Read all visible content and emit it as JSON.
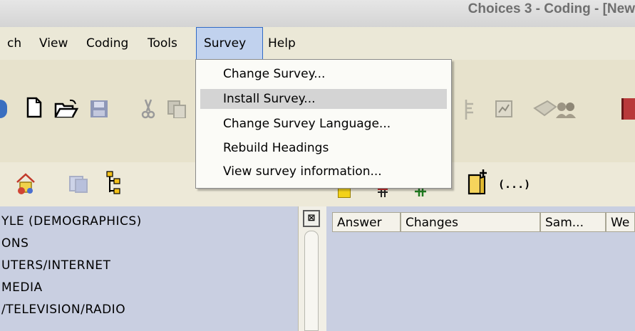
{
  "window": {
    "title": "Choices 3 - Coding - [New"
  },
  "menubar": {
    "items": [
      {
        "label": "ch"
      },
      {
        "label": "View"
      },
      {
        "label": "Coding"
      },
      {
        "label": "Tools"
      },
      {
        "label": "Survey"
      },
      {
        "label": "Help"
      }
    ]
  },
  "survey_menu": {
    "items": [
      {
        "label": "Change Survey..."
      },
      {
        "label": "Install Survey..."
      },
      {
        "label": "Change Survey Language..."
      },
      {
        "label": "Rebuild Headings"
      },
      {
        "label": "View survey information..."
      }
    ]
  },
  "toolbar2": {
    "brackets_label": "(...)"
  },
  "tree": {
    "items": [
      {
        "label": "YLE (DEMOGRAPHICS)"
      },
      {
        "label": "ONS"
      },
      {
        "label": "UTERS/INTERNET"
      },
      {
        "label": " MEDIA"
      },
      {
        "label": "/TELEVISION/RADIO"
      }
    ]
  },
  "grid": {
    "columns": [
      {
        "label": "Answer"
      },
      {
        "label": "Changes"
      },
      {
        "label": "Sam..."
      },
      {
        "label": "We"
      }
    ]
  },
  "colors": {
    "tree_bg": "#c9cfe1",
    "menu_active_bg": "#c1d2ee",
    "dropdown_hover": "#d4d4d4"
  }
}
